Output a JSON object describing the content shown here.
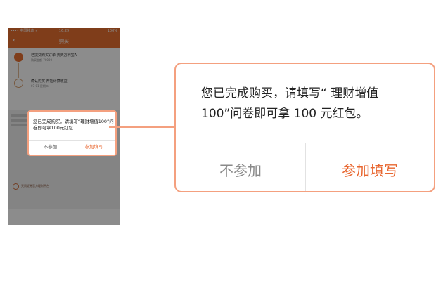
{
  "phone": {
    "status": {
      "carrier": "•••• 中国移动 ✓",
      "time": "16:29",
      "battery": "100%"
    },
    "nav": {
      "back": "‹",
      "title": "购买"
    },
    "steps": [
      {
        "title": "已提交购买订单 天天万利宝A",
        "sub": "购买金额 70000"
      },
      {
        "title": "确认购买 开始计算收益",
        "sub": "07-01 星期二"
      }
    ],
    "footer_brand": "天同证券官方理财平台"
  },
  "dialog": {
    "message": "您已完成购买，请填写“ 理财增值100”问卷即可拿 100 元红包。",
    "mini_message": "您已完成购买，请填写“理财增值100”问卷即可拿100元红包",
    "decline_label": "不参加",
    "accept_label": "参加填写"
  },
  "colors": {
    "accent": "#e8662f",
    "highlight": "#f4a07f",
    "brand": "#e87030"
  }
}
